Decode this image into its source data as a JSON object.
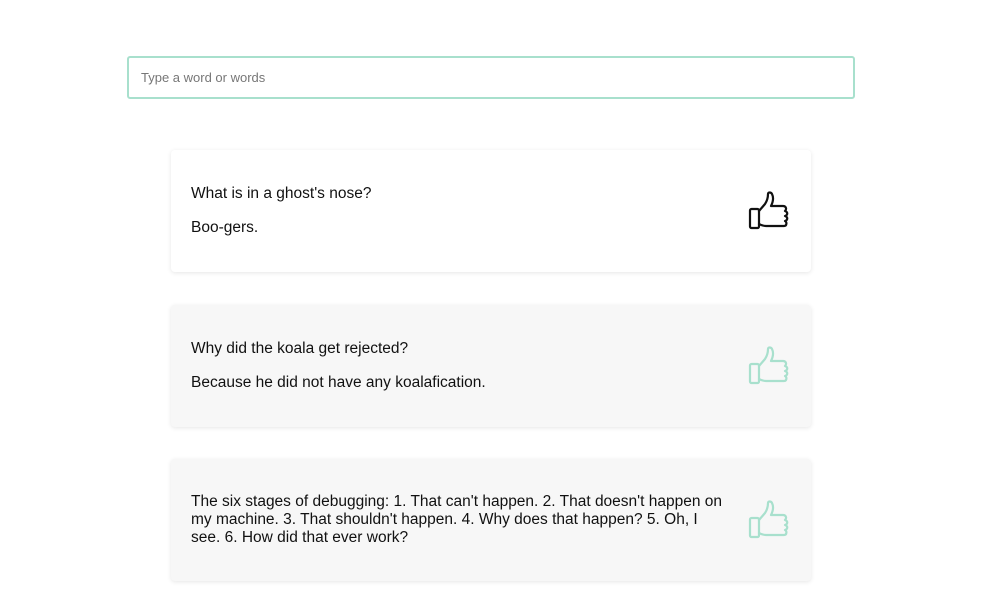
{
  "search": {
    "placeholder": "Type a word or words",
    "value": ""
  },
  "jokes": [
    {
      "setup": "What is in a ghost's nose?",
      "punchline": "Boo-gers.",
      "liked": true,
      "icon": "thumbs-up-icon",
      "icon_color": "#111111"
    },
    {
      "setup": "Why did the koala get rejected?",
      "punchline": "Because he did not have any koalafication.",
      "liked": false,
      "icon": "thumbs-up-icon",
      "icon_color": "#a8e0cd"
    },
    {
      "text": "The six stages of debugging: 1. That can't happen. 2. That doesn't happen on my machine. 3. That shouldn't happen. 4. Why does that happen? 5. Oh, I see. 6. How did that ever work?",
      "liked": false,
      "icon": "thumbs-up-icon",
      "icon_color": "#a8e0cd"
    }
  ],
  "colors": {
    "accent": "#a8e0cd",
    "card_bg": "#f7f7f7",
    "liked_icon": "#111111"
  }
}
